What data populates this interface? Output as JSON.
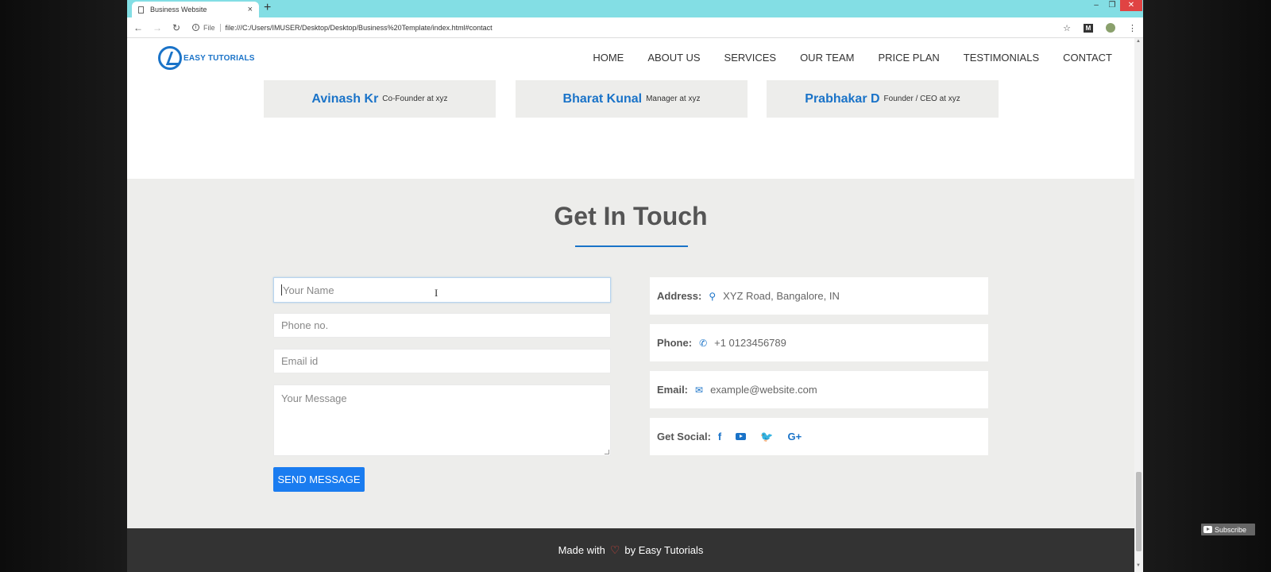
{
  "browser": {
    "tab_title": "Business Website",
    "new_tab": "+",
    "close": "×",
    "scheme": "File",
    "url": "file:///C:/Users/IMUSER/Desktop/Desktop/Business%20Template/index.html#contact",
    "minimize": "–",
    "maximize": "❐",
    "window_close": "✕"
  },
  "navbar": {
    "logo_text": "EASY TUTORIALS",
    "items": [
      "HOME",
      "ABOUT US",
      "SERVICES",
      "OUR TEAM",
      "PRICE PLAN",
      "TESTIMONIALS",
      "CONTACT"
    ]
  },
  "team": [
    {
      "name": "Avinash Kr",
      "role": "Co-Founder at xyz"
    },
    {
      "name": "Bharat Kunal",
      "role": "Manager at xyz"
    },
    {
      "name": "Prabhakar D",
      "role": "Founder / CEO at xyz"
    }
  ],
  "contact": {
    "title": "Get In Touch",
    "form": {
      "name_placeholder": "Your Name",
      "phone_placeholder": "Phone no.",
      "email_placeholder": "Email id",
      "message_placeholder": "Your Message",
      "send_label": "SEND MESSAGE"
    },
    "info": {
      "address_label": "Address:",
      "address_value": "XYZ Road, Bangalore, IN",
      "phone_label": "Phone:",
      "phone_value": "+1 0123456789",
      "email_label": "Email:",
      "email_value": "example@website.com",
      "social_label": "Get Social:"
    },
    "accent_color": "#1a73c8"
  },
  "footer": {
    "made_with": "Made with",
    "by": "by Easy Tutorials"
  },
  "overlay": {
    "subscribe": "Subscribe"
  }
}
